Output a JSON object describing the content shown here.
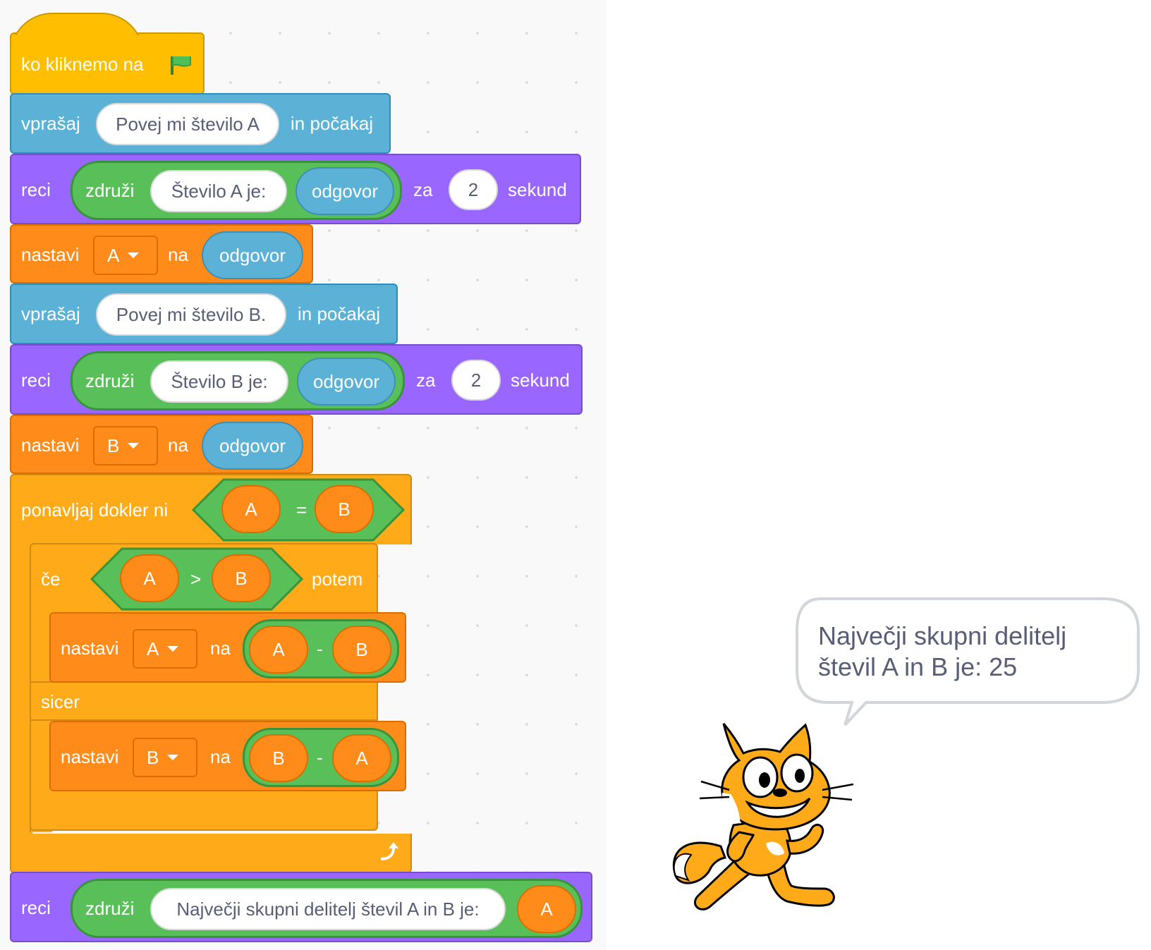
{
  "script": {
    "hat": {
      "label": "ko kliknemo na",
      "icon": "green-flag-icon"
    },
    "ask_a": {
      "label": "vprašaj",
      "question": "Povej mi število A",
      "suffix": "in počakaj"
    },
    "say_a": {
      "label": "reci",
      "join": "združi",
      "text": "Število A je:",
      "reporter": "odgovor",
      "za": "za",
      "seconds": "2",
      "unit": "sekund"
    },
    "set_a": {
      "label": "nastavi",
      "var": "A",
      "na": "na",
      "value": "odgovor"
    },
    "ask_b": {
      "label": "vprašaj",
      "question": "Povej mi število B.",
      "suffix": "in počakaj"
    },
    "say_b": {
      "label": "reci",
      "join": "združi",
      "text": "Število B je:",
      "reporter": "odgovor",
      "za": "za",
      "seconds": "2",
      "unit": "sekund"
    },
    "set_b": {
      "label": "nastavi",
      "var": "B",
      "na": "na",
      "value": "odgovor"
    },
    "repeat": {
      "label": "ponavljaj dokler ni",
      "left": "A",
      "op": "=",
      "right": "B",
      "icon": "loop-arrow-icon"
    },
    "if": {
      "label": "če",
      "left": "A",
      "op": ">",
      "right": "B",
      "then": "potem",
      "else": "sicer"
    },
    "set_a_sub": {
      "label": "nastavi",
      "var": "A",
      "na": "na",
      "left": "A",
      "op": "-",
      "right": "B"
    },
    "set_b_sub": {
      "label": "nastavi",
      "var": "B",
      "na": "na",
      "left": "B",
      "op": "-",
      "right": "A"
    },
    "say_final": {
      "label": "reci",
      "join": "združi",
      "text": "Največji skupni delitelj števil A in B je:",
      "reporter": "A"
    }
  },
  "stage": {
    "speech_line1": "Največji skupni delitelj",
    "speech_line2": "števil A in B je: 25",
    "sprite": "scratch-cat"
  },
  "colors": {
    "events": "#ffbf00",
    "sensing": "#5cb1d6",
    "looks": "#9966ff",
    "variables": "#ff8c1a",
    "control": "#ffab19",
    "operators": "#59c059"
  }
}
